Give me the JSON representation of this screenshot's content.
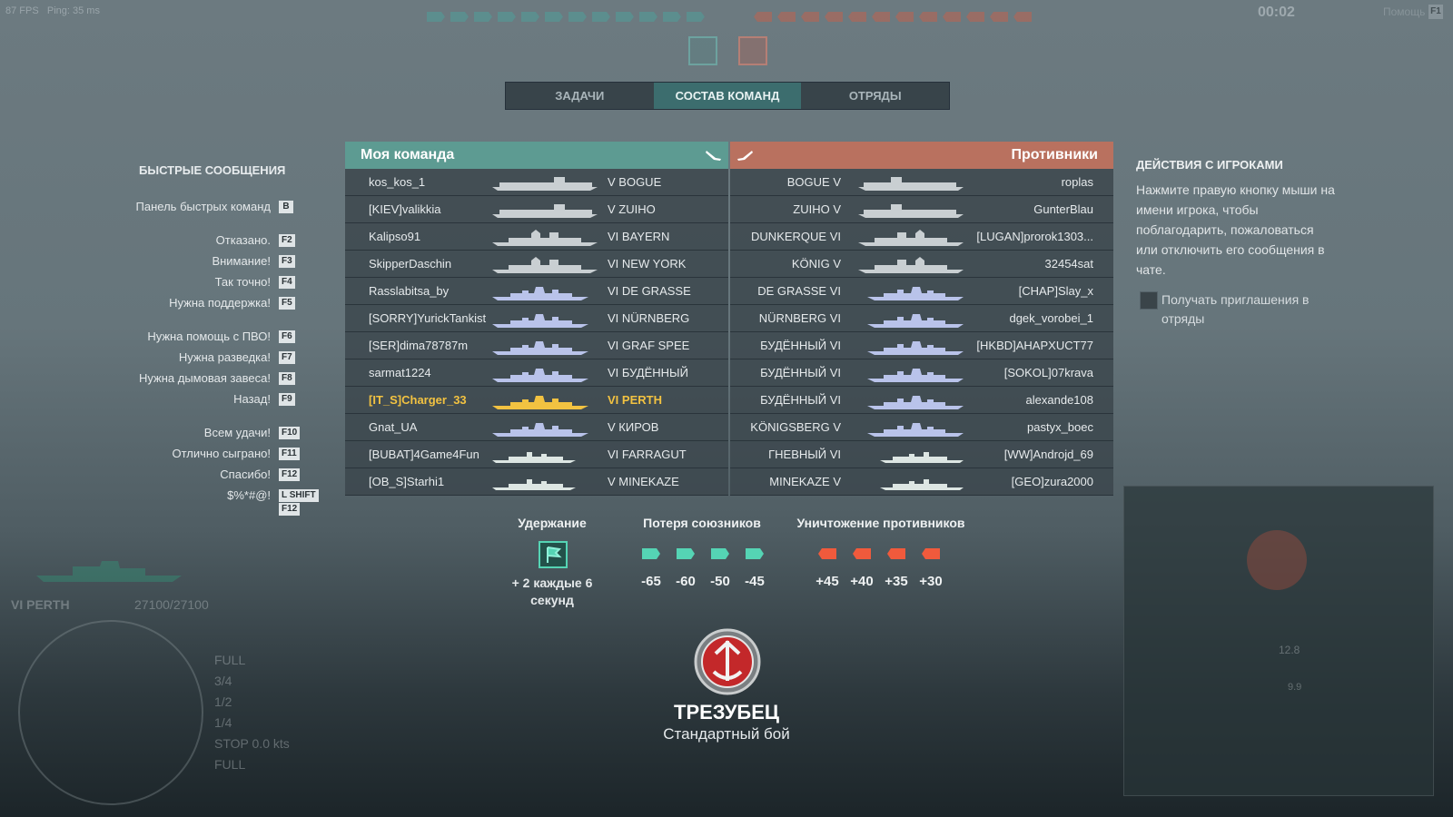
{
  "hud": {
    "fps": "87 FPS",
    "ping": "Ping: 35 ms",
    "timer": "00:02",
    "help_label": "Помощь",
    "help_key": "F1"
  },
  "tabs": [
    {
      "label": "ЗАДАЧИ",
      "active": false
    },
    {
      "label": "СОСТАВ КОМАНД",
      "active": true
    },
    {
      "label": "ОТРЯДЫ",
      "active": false
    }
  ],
  "quick_messages": {
    "title": "БЫСТРЫЕ СООБЩЕНИЯ",
    "items": [
      {
        "label": "Панель быстрых команд",
        "key": "B"
      },
      {
        "label": "Отказано.",
        "key": "F2"
      },
      {
        "label": "Внимание!",
        "key": "F3"
      },
      {
        "label": "Так точно!",
        "key": "F4"
      },
      {
        "label": "Нужна поддержка!",
        "key": "F5"
      },
      {
        "label": "Нужна помощь с ПВО!",
        "key": "F6"
      },
      {
        "label": "Нужна разведка!",
        "key": "F7"
      },
      {
        "label": "Нужна дымовая завеса!",
        "key": "F8"
      },
      {
        "label": "Назад!",
        "key": "F9"
      },
      {
        "label": "Всем удачи!",
        "key": "F10"
      },
      {
        "label": "Отлично сыграно!",
        "key": "F11"
      },
      {
        "label": "Спасибо!",
        "key": "F12"
      },
      {
        "label": "$%*#@!",
        "key": "L SHIFT",
        "key2": "F12"
      }
    ]
  },
  "my_team": {
    "title": "Моя команда",
    "players": [
      {
        "name": "kos_kos_1",
        "ship": "V  BOGUE",
        "class": "carrier"
      },
      {
        "name": "[KIEV]valikkia",
        "ship": "V  ZUIHO",
        "class": "carrier"
      },
      {
        "name": "Kalipso91",
        "ship": "VI  BAYERN",
        "class": "battleship"
      },
      {
        "name": "SkipperDaschin",
        "ship": "VI  NEW YORK",
        "class": "battleship"
      },
      {
        "name": "Rasslabitsa_by",
        "ship": "VI  DE GRASSE",
        "class": "cruiser"
      },
      {
        "name": "[SORRY]YurickTankist",
        "ship": "VI  NÜRNBERG",
        "class": "cruiser"
      },
      {
        "name": "[SER]dima78787m",
        "ship": "VI  GRAF SPEE",
        "class": "cruiser"
      },
      {
        "name": "sarmat1224",
        "ship": "VI  БУДЁННЫЙ",
        "class": "cruiser"
      },
      {
        "name": "[IT_S]Charger_33",
        "ship": "VI  PERTH",
        "class": "cruiser",
        "me": true
      },
      {
        "name": "Gnat_UA",
        "ship": "V  КИРОВ",
        "class": "cruiser"
      },
      {
        "name": "[BUBAT]4Game4Fun",
        "ship": "VI  FARRAGUT",
        "class": "destroyer"
      },
      {
        "name": "[OB_S]Starhi1",
        "ship": "V  MINEKAZE",
        "class": "destroyer"
      }
    ]
  },
  "enemy_team": {
    "title": "Противники",
    "players": [
      {
        "name": "roplas",
        "ship": "BOGUE  V",
        "class": "carrier"
      },
      {
        "name": "GunterBlau",
        "ship": "ZUIHO  V",
        "class": "carrier"
      },
      {
        "name": "[LUGAN]prorok1303...",
        "ship": "DUNKERQUE  VI",
        "class": "battleship"
      },
      {
        "name": "32454sat",
        "ship": "KÖNIG  V",
        "class": "battleship"
      },
      {
        "name": "[CHAP]Slay_x",
        "ship": "DE GRASSE  VI",
        "class": "cruiser"
      },
      {
        "name": "dgek_vorobei_1",
        "ship": "NÜRNBERG  VI",
        "class": "cruiser"
      },
      {
        "name": "[HKBD]AHAPXUCT77",
        "ship": "БУДЁННЫЙ  VI",
        "class": "cruiser"
      },
      {
        "name": "[SOKOL]07krava",
        "ship": "БУДЁННЫЙ  VI",
        "class": "cruiser"
      },
      {
        "name": "alexande108",
        "ship": "БУДЁННЫЙ  VI",
        "class": "cruiser"
      },
      {
        "name": "pastyx_boec",
        "ship": "KÖNIGSBERG  V",
        "class": "cruiser"
      },
      {
        "name": "[WW]Androjd_69",
        "ship": "ГНЕВНЫЙ  VI",
        "class": "destroyer"
      },
      {
        "name": "[GEO]zura2000",
        "ship": "MINEKAZE  V",
        "class": "destroyer"
      }
    ]
  },
  "player_actions": {
    "title": "ДЕЙСТВИЯ С ИГРОКАМИ",
    "text": "Нажмите правую кнопку мыши на имени игрока, чтобы поблагодарить, пожаловаться или отключить его сообщения в чате.",
    "checkbox_label": "Получать приглашения в отряды",
    "checkbox_checked": false
  },
  "scoring": {
    "hold_title": "Удержание",
    "hold_value": "+ 2 каждые 6 секунд",
    "ally_loss_title": "Потеря союзников",
    "ally_loss_values": [
      "-65",
      "-60",
      "-50",
      "-45"
    ],
    "enemy_kill_title": "Уничтожение противников",
    "enemy_kill_values": [
      "+45",
      "+40",
      "+35",
      "+30"
    ]
  },
  "battle": {
    "mode_title": "ТРЕЗУБЕЦ",
    "mode_subtitle": "Стандартный бой"
  },
  "ship_status": {
    "name": "VI PERTH",
    "hp": "27100/27100",
    "speed": "0.0 kts",
    "throttle": [
      "FULL",
      "3/4",
      "1/2",
      "1/4",
      "STOP",
      "FULL"
    ],
    "minimap_values": [
      "12.8",
      "9.9"
    ]
  },
  "colors": {
    "ally": "#5d9b92",
    "enemy": "#b9715f",
    "highlight": "#f2c241",
    "ally_icon": "#55d4b4",
    "enemy_icon": "#f05a3c"
  }
}
